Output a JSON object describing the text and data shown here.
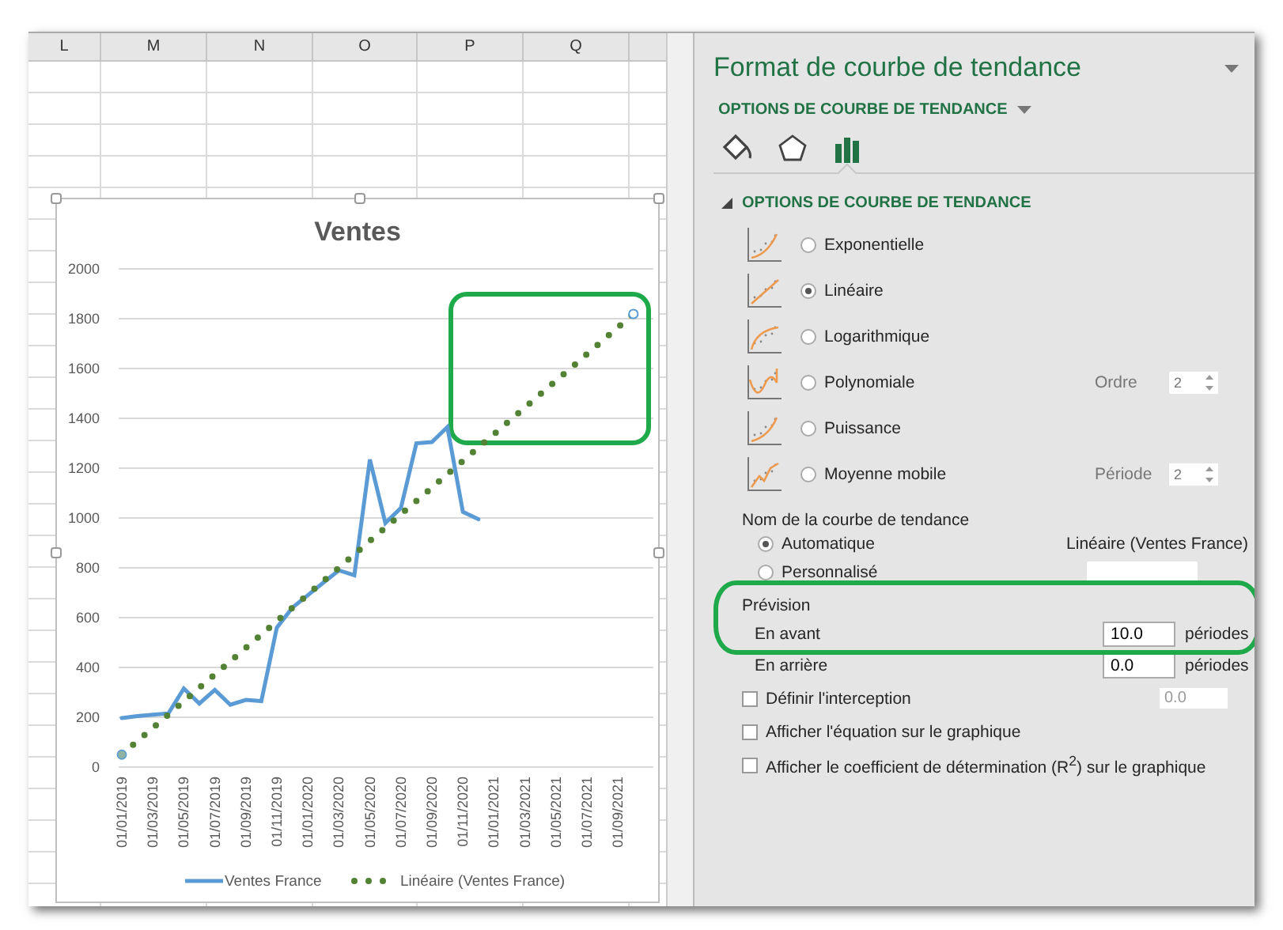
{
  "sheet": {
    "columns": [
      "L",
      "M",
      "N",
      "O",
      "P",
      "Q"
    ]
  },
  "chart": {
    "chart_data": {
      "type": "line",
      "title": "Ventes",
      "ylim": [
        0,
        2000
      ],
      "yticks": [
        0,
        200,
        400,
        600,
        800,
        1000,
        1200,
        1400,
        1600,
        1800,
        2000
      ],
      "grid": true,
      "legend": "bottom",
      "categories": [
        "01/01/2019",
        null,
        "01/03/2019",
        null,
        "01/05/2019",
        null,
        "01/07/2019",
        null,
        "01/09/2019",
        null,
        "01/11/2019",
        null,
        "01/01/2020",
        null,
        "01/03/2020",
        null,
        "01/05/2020",
        null,
        "01/07/2020",
        null,
        "01/09/2020",
        null,
        "01/11/2020",
        null,
        "01/01/2021",
        null,
        "01/03/2021",
        null,
        "01/05/2021",
        null,
        "01/07/2021",
        null,
        "01/09/2021",
        null
      ],
      "series": [
        {
          "name": "Ventes France",
          "color": "#5b9bd5",
          "line_style": "solid",
          "values": [
            197,
            205,
            210,
            215,
            315,
            255,
            310,
            250,
            270,
            265,
            560,
            640,
            690,
            740,
            790,
            770,
            1235,
            980,
            1040,
            1300,
            1305,
            1365,
            1025,
            995,
            null,
            null,
            null,
            null,
            null,
            null,
            null,
            null,
            null,
            null
          ]
        },
        {
          "name": "Linéaire (Ventes France)",
          "color": "#548235",
          "line_style": "dotted",
          "values": [
            50,
            104,
            157,
            211,
            264,
            318,
            372,
            425,
            479,
            532,
            586,
            640,
            693,
            747,
            800,
            854,
            908,
            961,
            1015,
            1068,
            1122,
            1176,
            1229,
            1283,
            1336,
            1390,
            1444,
            1497,
            1551,
            1604,
            1658,
            1712,
            1765,
            1819
          ]
        }
      ]
    }
  },
  "pane": {
    "title": "Format de courbe de tendance",
    "section_menu": "OPTIONS DE COURBE DE TENDANCE",
    "tabs": [
      {
        "kind": "fill",
        "selected": false
      },
      {
        "kind": "effects",
        "selected": false
      },
      {
        "kind": "options",
        "selected": true
      }
    ],
    "section": {
      "title": "OPTIONS DE COURBE DE TENDANCE",
      "expanded": true
    },
    "trend_types": [
      {
        "kind": "exponential",
        "label": "Exponentielle",
        "selected": false
      },
      {
        "kind": "linear",
        "label": "Linéaire",
        "selected": true
      },
      {
        "kind": "logarithmic",
        "label": "Logarithmique",
        "selected": false
      },
      {
        "kind": "polynomial",
        "label": "Polynomiale",
        "selected": false,
        "param_label": "Ordre",
        "param_value": "2"
      },
      {
        "kind": "power",
        "label": "Puissance",
        "selected": false
      },
      {
        "kind": "moving",
        "label": "Moyenne mobile",
        "selected": false,
        "param_label": "Période",
        "param_value": "2"
      }
    ],
    "name_label": "Nom de la courbe de tendance",
    "name_options": [
      {
        "label": "Automatique",
        "selected": true,
        "value": "Linéaire (Ventes France)"
      },
      {
        "label": "Personnalisé",
        "selected": false
      }
    ],
    "forecast": {
      "title": "Prévision",
      "rows": [
        {
          "label": "En avant",
          "value": "10.0",
          "unit": "périodes"
        },
        {
          "label": "En arrière",
          "value": "0.0",
          "unit": "périodes"
        }
      ]
    },
    "checks": [
      {
        "label": "Définir l'interception",
        "checked": false,
        "placeholder": "0.0"
      },
      {
        "label": "Afficher l'équation sur le graphique",
        "checked": false
      },
      {
        "label": "Afficher le coefficient de détermination (R$^{2}$) sur le graphique",
        "checked": false
      }
    ]
  }
}
